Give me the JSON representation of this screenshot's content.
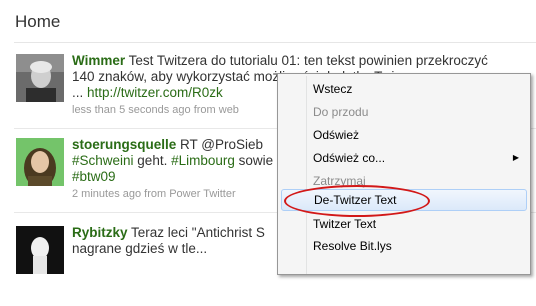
{
  "page": {
    "title": "Home"
  },
  "tweets": [
    {
      "username": "Wimmer",
      "text": " Test Twitzera do tutorialu 01: ten tekst powinien przekroczyć 140 znaków, aby wykorzystać możliwości dodatku Twi",
      "ellipsis": "... ",
      "link": "http://twitzer.com/R0zk",
      "meta": "less than 5 seconds ago from web"
    },
    {
      "username": "stoerungsquelle",
      "text_prefix": " RT @ProSieb",
      "hashtags": [
        "#Schweini",
        "#Limbourg",
        "#btw09"
      ],
      "text_mid1": " geht. ",
      "text_mid2": " sowie",
      "meta": "2 minutes ago from Power Twitter"
    },
    {
      "username": "Rybitzky",
      "text": " Teraz leci \"Antichrist S",
      "text2": "nagrane gdzieś w tle..."
    }
  ],
  "context_menu": {
    "items": [
      {
        "label": "Wstecz",
        "enabled": true
      },
      {
        "label": "Do przodu",
        "enabled": false
      },
      {
        "label": "Odśwież",
        "enabled": true
      },
      {
        "label": "Odśwież co...",
        "enabled": true,
        "submenu": true
      },
      {
        "label": "Zatrzymaj",
        "enabled": false
      },
      {
        "label": "De-Twitzer Text",
        "enabled": true,
        "highlighted": true
      },
      {
        "label": "Twitzer Text",
        "enabled": true
      },
      {
        "label": "Resolve Bit.lys",
        "enabled": true
      }
    ],
    "submenu_arrow": "▶"
  },
  "colors": {
    "accent_green": "#2a6c16",
    "highlight_circle": "#d21818"
  }
}
